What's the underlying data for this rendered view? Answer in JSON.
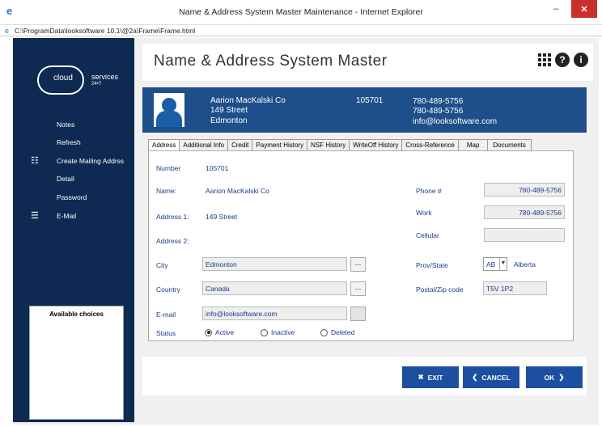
{
  "window": {
    "title": "Name & Address System Master Maintenance - Internet Explorer",
    "minimize": "–",
    "maximize": "☐",
    "close": "✕"
  },
  "address_bar": {
    "url": "C:\\ProgramData\\looksoftware 10.1\\@2a\\Frame\\Frame.html"
  },
  "logo": {
    "cloud": "cloud",
    "services": "services",
    "tagline": "24•7"
  },
  "sidebar": {
    "items": [
      {
        "label": "Notes",
        "icon": ""
      },
      {
        "label": "Refresh",
        "icon": ""
      },
      {
        "label": "Create Mailing Addrss",
        "icon": "list-icon"
      },
      {
        "label": "Detail",
        "icon": ""
      },
      {
        "label": "Password",
        "icon": ""
      },
      {
        "label": "E-Mail",
        "icon": "menu-icon"
      }
    ],
    "available_choices": "Available choices"
  },
  "page": {
    "title": "Name & Address System Master"
  },
  "banner": {
    "name": "Aarion MacKalski Co",
    "street": "149 Street",
    "city": "Edmonton",
    "number": "105701",
    "phone1": "780-489-5756",
    "phone2": "780-489-5756",
    "email": "info@looksoftware.com"
  },
  "tabs": [
    "Address",
    "Additional Info",
    "Credit",
    "Payment History",
    "NSF History",
    "WriteOff History",
    "Cross-Reference",
    "Map",
    "Documents"
  ],
  "form": {
    "number_label": "Number",
    "number_value": "105701",
    "name_label": "Name:",
    "name_value": "Aarion MacKalski Co",
    "address1_label": "Address 1:",
    "address1_value": "149 Street",
    "address2_label": "Address 2:",
    "city_label": "City",
    "city_value": "Edmonton",
    "country_label": "Country",
    "country_value": "Canada",
    "email_label": "E-mail",
    "email_value": "info@looksoftware.com",
    "status_label": "Status",
    "status_options": [
      "Active",
      "Inactive",
      "Deleted"
    ],
    "status_selected": "Active",
    "phone_label": "Phone #",
    "phone_value": "780-489-5756",
    "work_label": "Work",
    "work_value": "780-489-5756",
    "cellular_label": "Cellular",
    "cellular_value": "",
    "prov_label": "Prov/State",
    "prov_code": "AB",
    "prov_name": "Alberta",
    "postal_label": "Postal/Zip code",
    "postal_value": "T5V 1P2",
    "dots": "..."
  },
  "footer": {
    "exit": "EXIT",
    "cancel": "CANCEL",
    "ok": "OK"
  },
  "colors": {
    "sidebar": "#0e2a52",
    "banner": "#1e4f8a",
    "button": "#1d4fa0",
    "label": "#1e3a8a"
  }
}
